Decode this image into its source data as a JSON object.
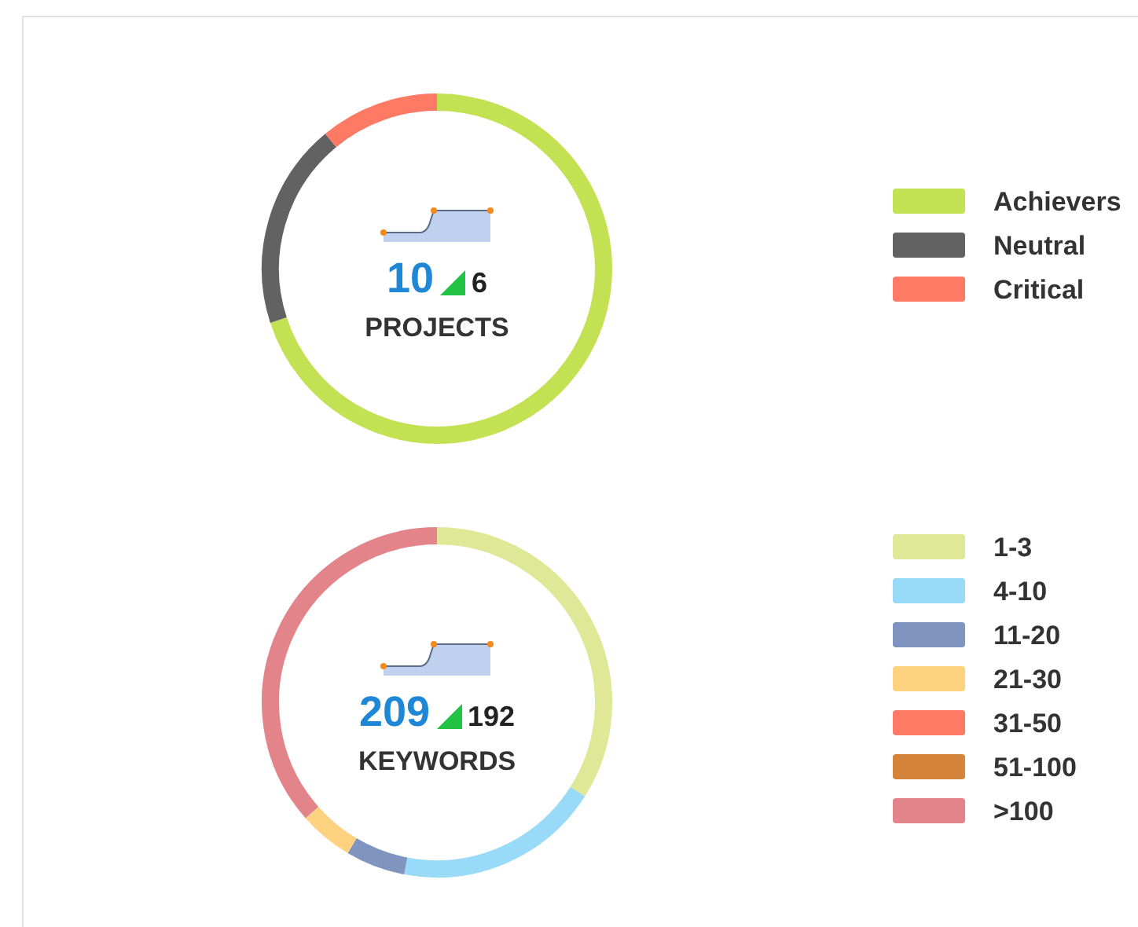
{
  "widgets": [
    {
      "count": "10",
      "change": "6",
      "label": "PROJECTS",
      "legend": [
        {
          "label": "Achievers",
          "color": "#c3e153"
        },
        {
          "label": "Neutral",
          "color": "#626262"
        },
        {
          "label": "Critical",
          "color": "#ff7a65"
        }
      ]
    },
    {
      "count": "209",
      "change": "192",
      "label": "KEYWORDS",
      "legend": [
        {
          "label": "1-3",
          "color": "#dfe896"
        },
        {
          "label": "4-10",
          "color": "#98daf7"
        },
        {
          "label": "11-20",
          "color": "#7f94be"
        },
        {
          "label": "21-30",
          "color": "#fed280"
        },
        {
          "label": "31-50",
          "color": "#ff7a65"
        },
        {
          "label": "51-100",
          "color": "#d5843b"
        },
        {
          "label": ">100",
          "color": "#e3848b"
        }
      ]
    }
  ]
}
